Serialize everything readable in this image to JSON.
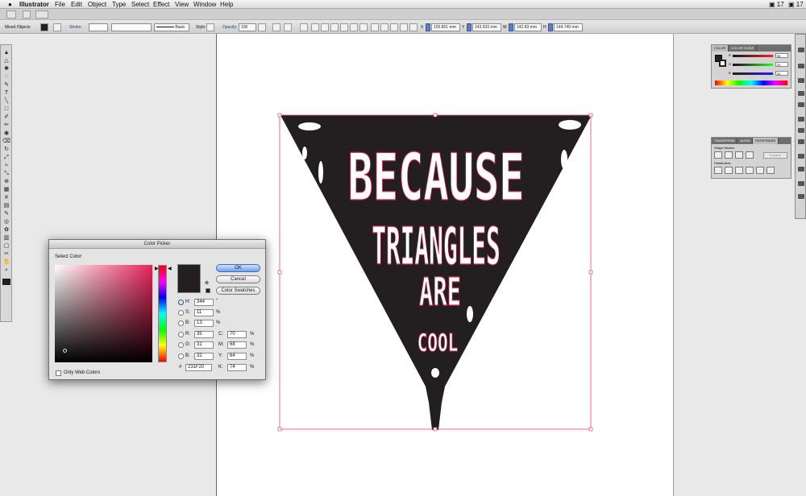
{
  "menubar": {
    "apple": "",
    "app_name": "Illustrator",
    "items": [
      "File",
      "Edit",
      "Object",
      "Type",
      "Select",
      "Effect",
      "View",
      "Window",
      "Help"
    ],
    "right_a": "17",
    "right_b": "17"
  },
  "control_bar": {
    "selection_label": "Mixed Objects",
    "stroke_label": "Stroke:",
    "stroke_profile": "Basic",
    "style_label": "Style:",
    "opacity_label": "Opacity:",
    "opacity_value": "100",
    "x_value": "100.851 mm",
    "y_value": "143.933 mm",
    "w_value": "142.83 mm",
    "h_value": "144.749 mm"
  },
  "toolbar": {
    "tools": [
      "selection-tool",
      "direct-selection-tool",
      "magic-wand-tool",
      "lasso-tool",
      "pen-tool",
      "type-tool",
      "line-tool",
      "rectangle-tool",
      "paintbrush-tool",
      "pencil-tool",
      "blob-brush-tool",
      "eraser-tool",
      "rotate-tool",
      "scale-tool",
      "width-tool",
      "free-transform-tool",
      "shape-builder-tool",
      "perspective-tool",
      "mesh-tool",
      "gradient-tool",
      "eyedropper-tool",
      "blend-tool",
      "symbol-sprayer-tool",
      "column-graph-tool",
      "artboard-tool",
      "slice-tool",
      "hand-tool",
      "zoom-tool"
    ]
  },
  "artwork": {
    "line1": "BECAUSE",
    "line2": "TRIANGLES",
    "line3": "ARE",
    "line4": "COOL"
  },
  "color_panel": {
    "tabs": [
      "COLOR",
      "COLOR GUIDE"
    ],
    "r_value": "35",
    "g_value": "31",
    "b_value": "32"
  },
  "pathfinder_panel": {
    "tabs": [
      "TRANSFORM",
      "ALIGN",
      "PATHFINDER"
    ],
    "shape_modes_label": "Shape Modes:",
    "expand_label": "Expand",
    "pathfinders_label": "Pathfinders:"
  },
  "color_picker": {
    "title": "Color Picker",
    "select_color_label": "Select Color:",
    "ok_label": "OK",
    "cancel_label": "Cancel",
    "swatches_label": "Color Swatches",
    "only_web_label": "Only Web Colors",
    "h_label": "H:",
    "h_value": "344",
    "h_unit": "°",
    "s_label": "S:",
    "s_value": "11",
    "s_unit": "%",
    "b_label": "B:",
    "b_value": "13",
    "b_unit": "%",
    "r_label": "R:",
    "r_value": "35",
    "g_label": "G:",
    "g_value": "31",
    "bb_label": "B:",
    "bb_value": "32",
    "hex_label": "#",
    "hex_value": "231F20",
    "c_label": "C:",
    "c_value": "70",
    "c_unit": "%",
    "m_label": "M:",
    "m_value": "68",
    "m_unit": "%",
    "y_label": "Y:",
    "y_value": "64",
    "y_unit": "%",
    "k_label": "K:",
    "k_value": "74",
    "k_unit": "%",
    "current_color": "#231F20",
    "hue_color": "#e8245a"
  }
}
